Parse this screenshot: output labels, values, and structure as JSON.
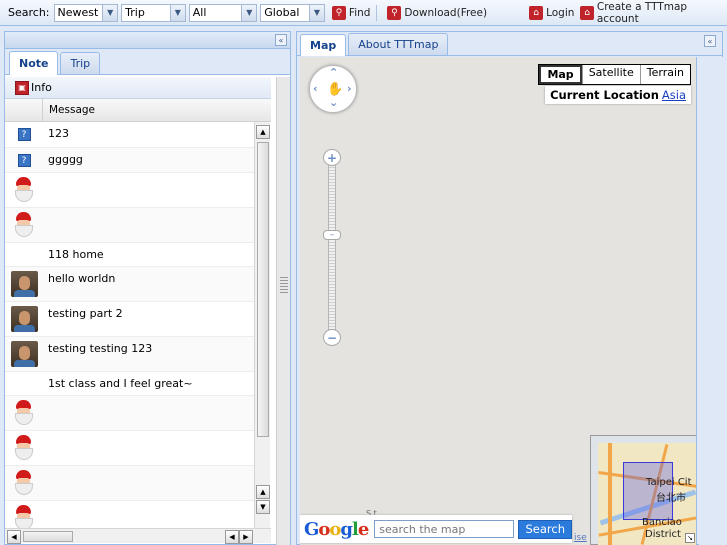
{
  "toolbar": {
    "search_label": "Search:",
    "selects": [
      {
        "name": "sort-select",
        "value": "Newest"
      },
      {
        "name": "type-select",
        "value": "Trip"
      },
      {
        "name": "category-select",
        "value": "All"
      },
      {
        "name": "scope-select",
        "value": "Global"
      }
    ],
    "find_label": "Find",
    "download_label": "Download(Free)",
    "login_label": "Login",
    "create_account_label": "Create a TTTmap account"
  },
  "left_panel": {
    "collapse_glyph": "«",
    "tabs": [
      {
        "label": "Note",
        "active": true
      },
      {
        "label": "Trip",
        "active": false
      }
    ],
    "info_label": "Info",
    "grid_header": "Message",
    "rows": [
      {
        "icon": "question-icon",
        "message": "123"
      },
      {
        "icon": "question-icon",
        "message": "ggggg"
      },
      {
        "icon": "santa-icon",
        "message": ""
      },
      {
        "icon": "santa-icon",
        "message": ""
      },
      {
        "icon": "none",
        "message": "118 home"
      },
      {
        "icon": "user-avatar",
        "message": "hello worldn"
      },
      {
        "icon": "user-avatar",
        "message": "testing part 2"
      },
      {
        "icon": "user-avatar",
        "message": "testing testing 123"
      },
      {
        "icon": "none",
        "message": "1st class and I feel great~"
      },
      {
        "icon": "santa-icon",
        "message": ""
      },
      {
        "icon": "santa-icon",
        "message": ""
      },
      {
        "icon": "santa-icon",
        "message": ""
      },
      {
        "icon": "santa-icon",
        "message": ""
      }
    ]
  },
  "right_panel": {
    "tabs": [
      {
        "label": "Map",
        "active": true
      },
      {
        "label": "About TTTmap",
        "active": false
      }
    ],
    "collapse_glyph": "«",
    "map_types": [
      "Map",
      "Satellite",
      "Terrain"
    ],
    "current_location_label": "Current Location",
    "current_location_value": "Asia",
    "search_placeholder": "search the map",
    "search_button": "Search",
    "google_logo": "Google",
    "terms_fragment": "ise",
    "stray_text": "S   t",
    "overview": {
      "city_label": "Taipei Cit",
      "city_label_cn": "台北市",
      "district_label_1": "Banciao",
      "district_label_2": "District"
    }
  },
  "colors": {
    "panel_border": "#99bbe8",
    "panel_bg": "#dfe8f6",
    "accent_red": "#c0242a",
    "link_blue": "#1a3dc1",
    "search_button_blue": "#2b7bdc",
    "map_bg": "#e5e3df"
  }
}
